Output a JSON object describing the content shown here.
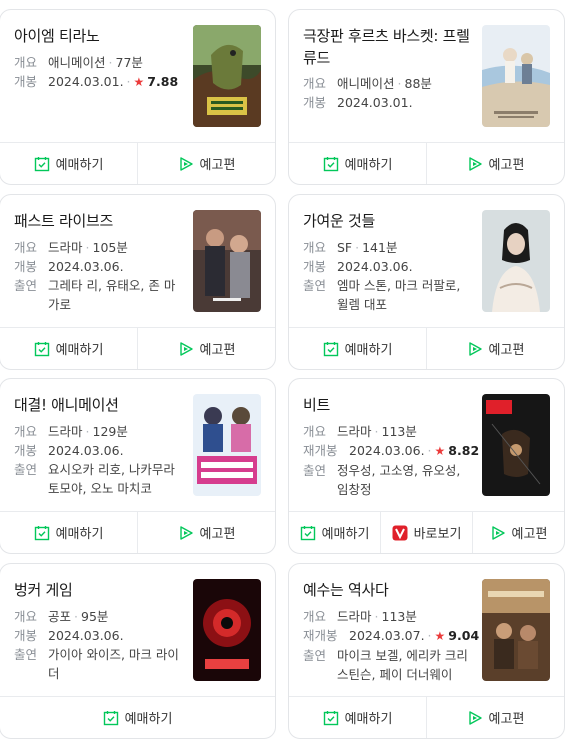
{
  "buttons": {
    "reserve": "예매하기",
    "trailer": "예고편",
    "watch": "바로보기"
  },
  "labels": {
    "overview": "개요",
    "release": "개봉",
    "rerelease": "재개봉",
    "cast": "출연"
  },
  "movies": [
    {
      "title": "아이엠 티라노",
      "genre": "애니메이션",
      "runtime": "77분",
      "release": "2024.03.01.",
      "rating": "7.88",
      "poster_icon": "poster-i-am-tyranno"
    },
    {
      "title": "극장판 후르츠 바스켓: 프렐류드",
      "genre": "애니메이션",
      "runtime": "88분",
      "release": "2024.03.01.",
      "poster_icon": "poster-fruits-basket"
    },
    {
      "title": "패스트 라이브즈",
      "genre": "드라마",
      "runtime": "105분",
      "release": "2024.03.06.",
      "cast": "그레타 리, 유태오, 존 마가로",
      "poster_icon": "poster-past-lives"
    },
    {
      "title": "가여운 것들",
      "genre": "SF",
      "runtime": "141분",
      "release": "2024.03.06.",
      "cast": "엠마 스톤, 마크 러팔로, 윌렘 대포",
      "poster_icon": "poster-poor-things"
    },
    {
      "title": "대결! 애니메이션",
      "genre": "드라마",
      "runtime": "129분",
      "release": "2024.03.06.",
      "cast": "요시오카 리호, 나카무라 토모야, 오노 마치코",
      "poster_icon": "poster-anime-showdown"
    },
    {
      "title": "비트",
      "genre": "드라마",
      "runtime": "113분",
      "rerelease": "2024.03.06.",
      "rating": "8.82",
      "cast": "정우성, 고소영, 유오성, 임창정",
      "poster_icon": "poster-beat"
    },
    {
      "title": "벙커 게임",
      "genre": "공포",
      "runtime": "95분",
      "release": "2024.03.06.",
      "cast": "가이아 와이즈, 마크 라이더",
      "poster_icon": "poster-bunker-game"
    },
    {
      "title": "예수는 역사다",
      "genre": "드라마",
      "runtime": "113분",
      "rerelease": "2024.03.07.",
      "rating": "9.04",
      "cast": "마이크 보겔, 에리카 크리스틴슨, 페이 더너웨이",
      "poster_icon": "poster-case-for-christ"
    }
  ],
  "colors": {
    "accent_green": "#03c75a",
    "star_red": "#eb3b3b"
  }
}
